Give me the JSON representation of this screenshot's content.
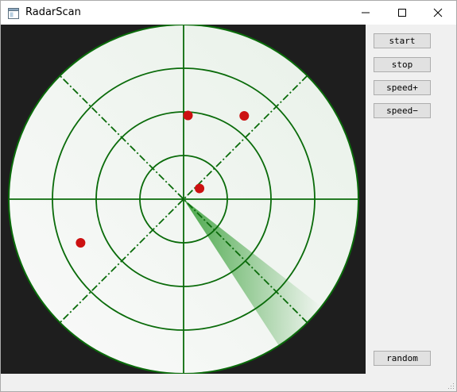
{
  "window": {
    "title": "RadarScan",
    "icon": "app-window-icon",
    "controls": [
      "minimize-icon",
      "maximize-icon",
      "close-icon"
    ]
  },
  "controls": {
    "start": "start",
    "stop": "stop",
    "speed_up": "speed+",
    "speed_down": "speed−",
    "random": "random"
  },
  "radar": {
    "ring_count": 4,
    "sweep_angle_from": 128,
    "sweep_angle_to": 147,
    "sweep_note_units": "degrees clockwise from north",
    "targets": [
      {
        "angle_deg": 3,
        "range": 0.48
      },
      {
        "angle_deg": 36,
        "range": 0.59
      },
      {
        "angle_deg": 247,
        "range": 0.64
      },
      {
        "angle_deg": 56,
        "range": 0.11
      }
    ],
    "colors": {
      "grid": "#0a6b0a",
      "face": "#f3f7f3",
      "sweep": "#2e9a2e",
      "target": "#cc1111",
      "background": "#1e1e1e"
    }
  }
}
